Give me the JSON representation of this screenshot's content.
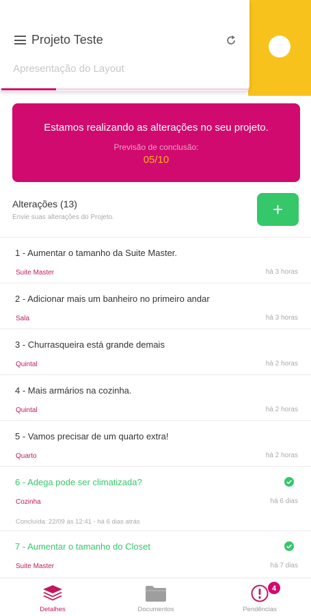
{
  "header": {
    "title": "Projeto Teste",
    "subtitle": "Apresentação do Layout",
    "progress_fraction": 0.22,
    "menu_icon": "hamburger-icon",
    "refresh_icon": "refresh-icon"
  },
  "banner": {
    "message": "Estamos realizando as alterações no seu projeto.",
    "forecast_label": "Previsão de conclusão:",
    "forecast_date": "05/10"
  },
  "changes": {
    "title": "Alterações (13)",
    "subtitle": "Envie suas alterações do Projeto.",
    "add_label": "+"
  },
  "items": [
    {
      "title": "1 - Aumentar o tamanho da Suite Master.",
      "category": "Suite Master",
      "time": "há 3 horas"
    },
    {
      "title": "2 - Adicionar mais um banheiro no primeiro andar",
      "category": "Sala",
      "time": "há 3 horas"
    },
    {
      "title": "3 - Churrasqueira está grande demais",
      "category": "Quintal",
      "time": "há 2 horas"
    },
    {
      "title": "4 - Mais armários na cozinha.",
      "category": "Quintal",
      "time": "há 2 horas"
    },
    {
      "title": "5 - Vamos precisar de um quarto extra!",
      "category": "Quarto",
      "time": "há 2 horas"
    },
    {
      "title": "6 - Adega pode ser climatizada?",
      "category": "Cozinha",
      "time": "há 6 dias",
      "done": true,
      "concluded": "Concluída: 22/09 às 12:41 - há 6 dias atrás"
    },
    {
      "title": "7 - Aumentar o tamanho do Closet",
      "category": "Suite Master",
      "time": "há 7 dias",
      "done": true
    }
  ],
  "nav": {
    "details": "Detalhes",
    "documents": "Documentos",
    "pending": "Pendências",
    "pending_badge": "4"
  },
  "colors": {
    "primary": "#d10a6f",
    "accent_yellow": "#f7c21b",
    "success": "#35c76a"
  }
}
